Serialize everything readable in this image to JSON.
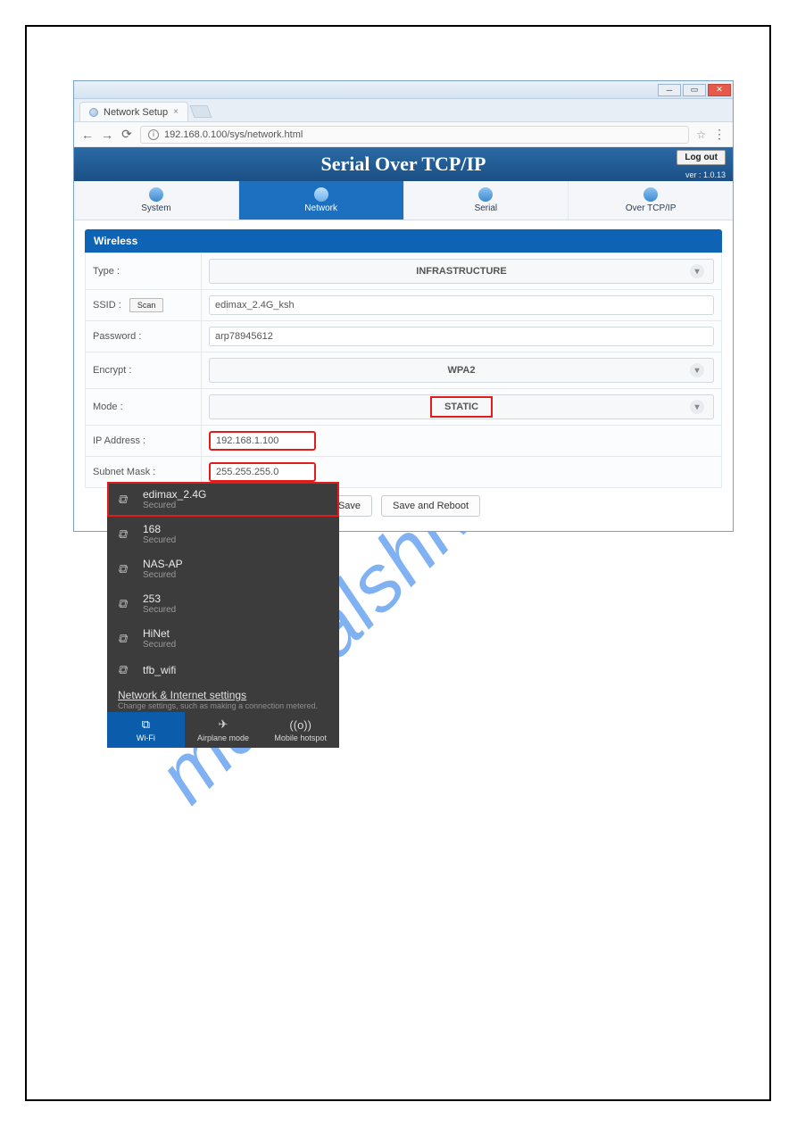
{
  "watermark": "manualshive.com",
  "browser": {
    "tab_title": "Network Setup",
    "url": "192.168.0.100/sys/network.html"
  },
  "banner": {
    "title": "Serial Over TCP/IP",
    "logout": "Log out",
    "version": "ver : 1.0.13"
  },
  "nav": {
    "system": "System",
    "network": "Network",
    "serial": "Serial",
    "overtcp": "Over TCP/IP"
  },
  "form": {
    "section": "Wireless",
    "type_label": "Type :",
    "type_value": "INFRASTRUCTURE",
    "ssid_label": "SSID :",
    "scan": "Scan",
    "ssid_value": "edimax_2.4G_ksh",
    "password_label": "Password :",
    "password_value": "arp78945612",
    "encrypt_label": "Encrypt :",
    "encrypt_value": "WPA2",
    "mode_label": "Mode :",
    "mode_value": "STATIC",
    "ip_label": "IP Address :",
    "ip_value": "192.168.1.100",
    "mask_label": "Subnet Mask :",
    "mask_value": "255.255.255.0",
    "save": "Save",
    "save_reboot": "Save and Reboot"
  },
  "wifi": {
    "items": [
      {
        "name": "edimax_2.4G",
        "status": "Secured"
      },
      {
        "name": "168",
        "status": "Secured"
      },
      {
        "name": "NAS-AP",
        "status": "Secured"
      },
      {
        "name": "253",
        "status": "Secured"
      },
      {
        "name": "HiNet",
        "status": "Secured"
      },
      {
        "name": "tfb_wifi",
        "status": ""
      }
    ],
    "settings_title": "Network & Internet settings",
    "settings_desc": "Change settings, such as making a connection metered.",
    "btn_wifi": "Wi-Fi",
    "btn_airplane": "Airplane mode",
    "btn_hotspot": "Mobile hotspot"
  }
}
